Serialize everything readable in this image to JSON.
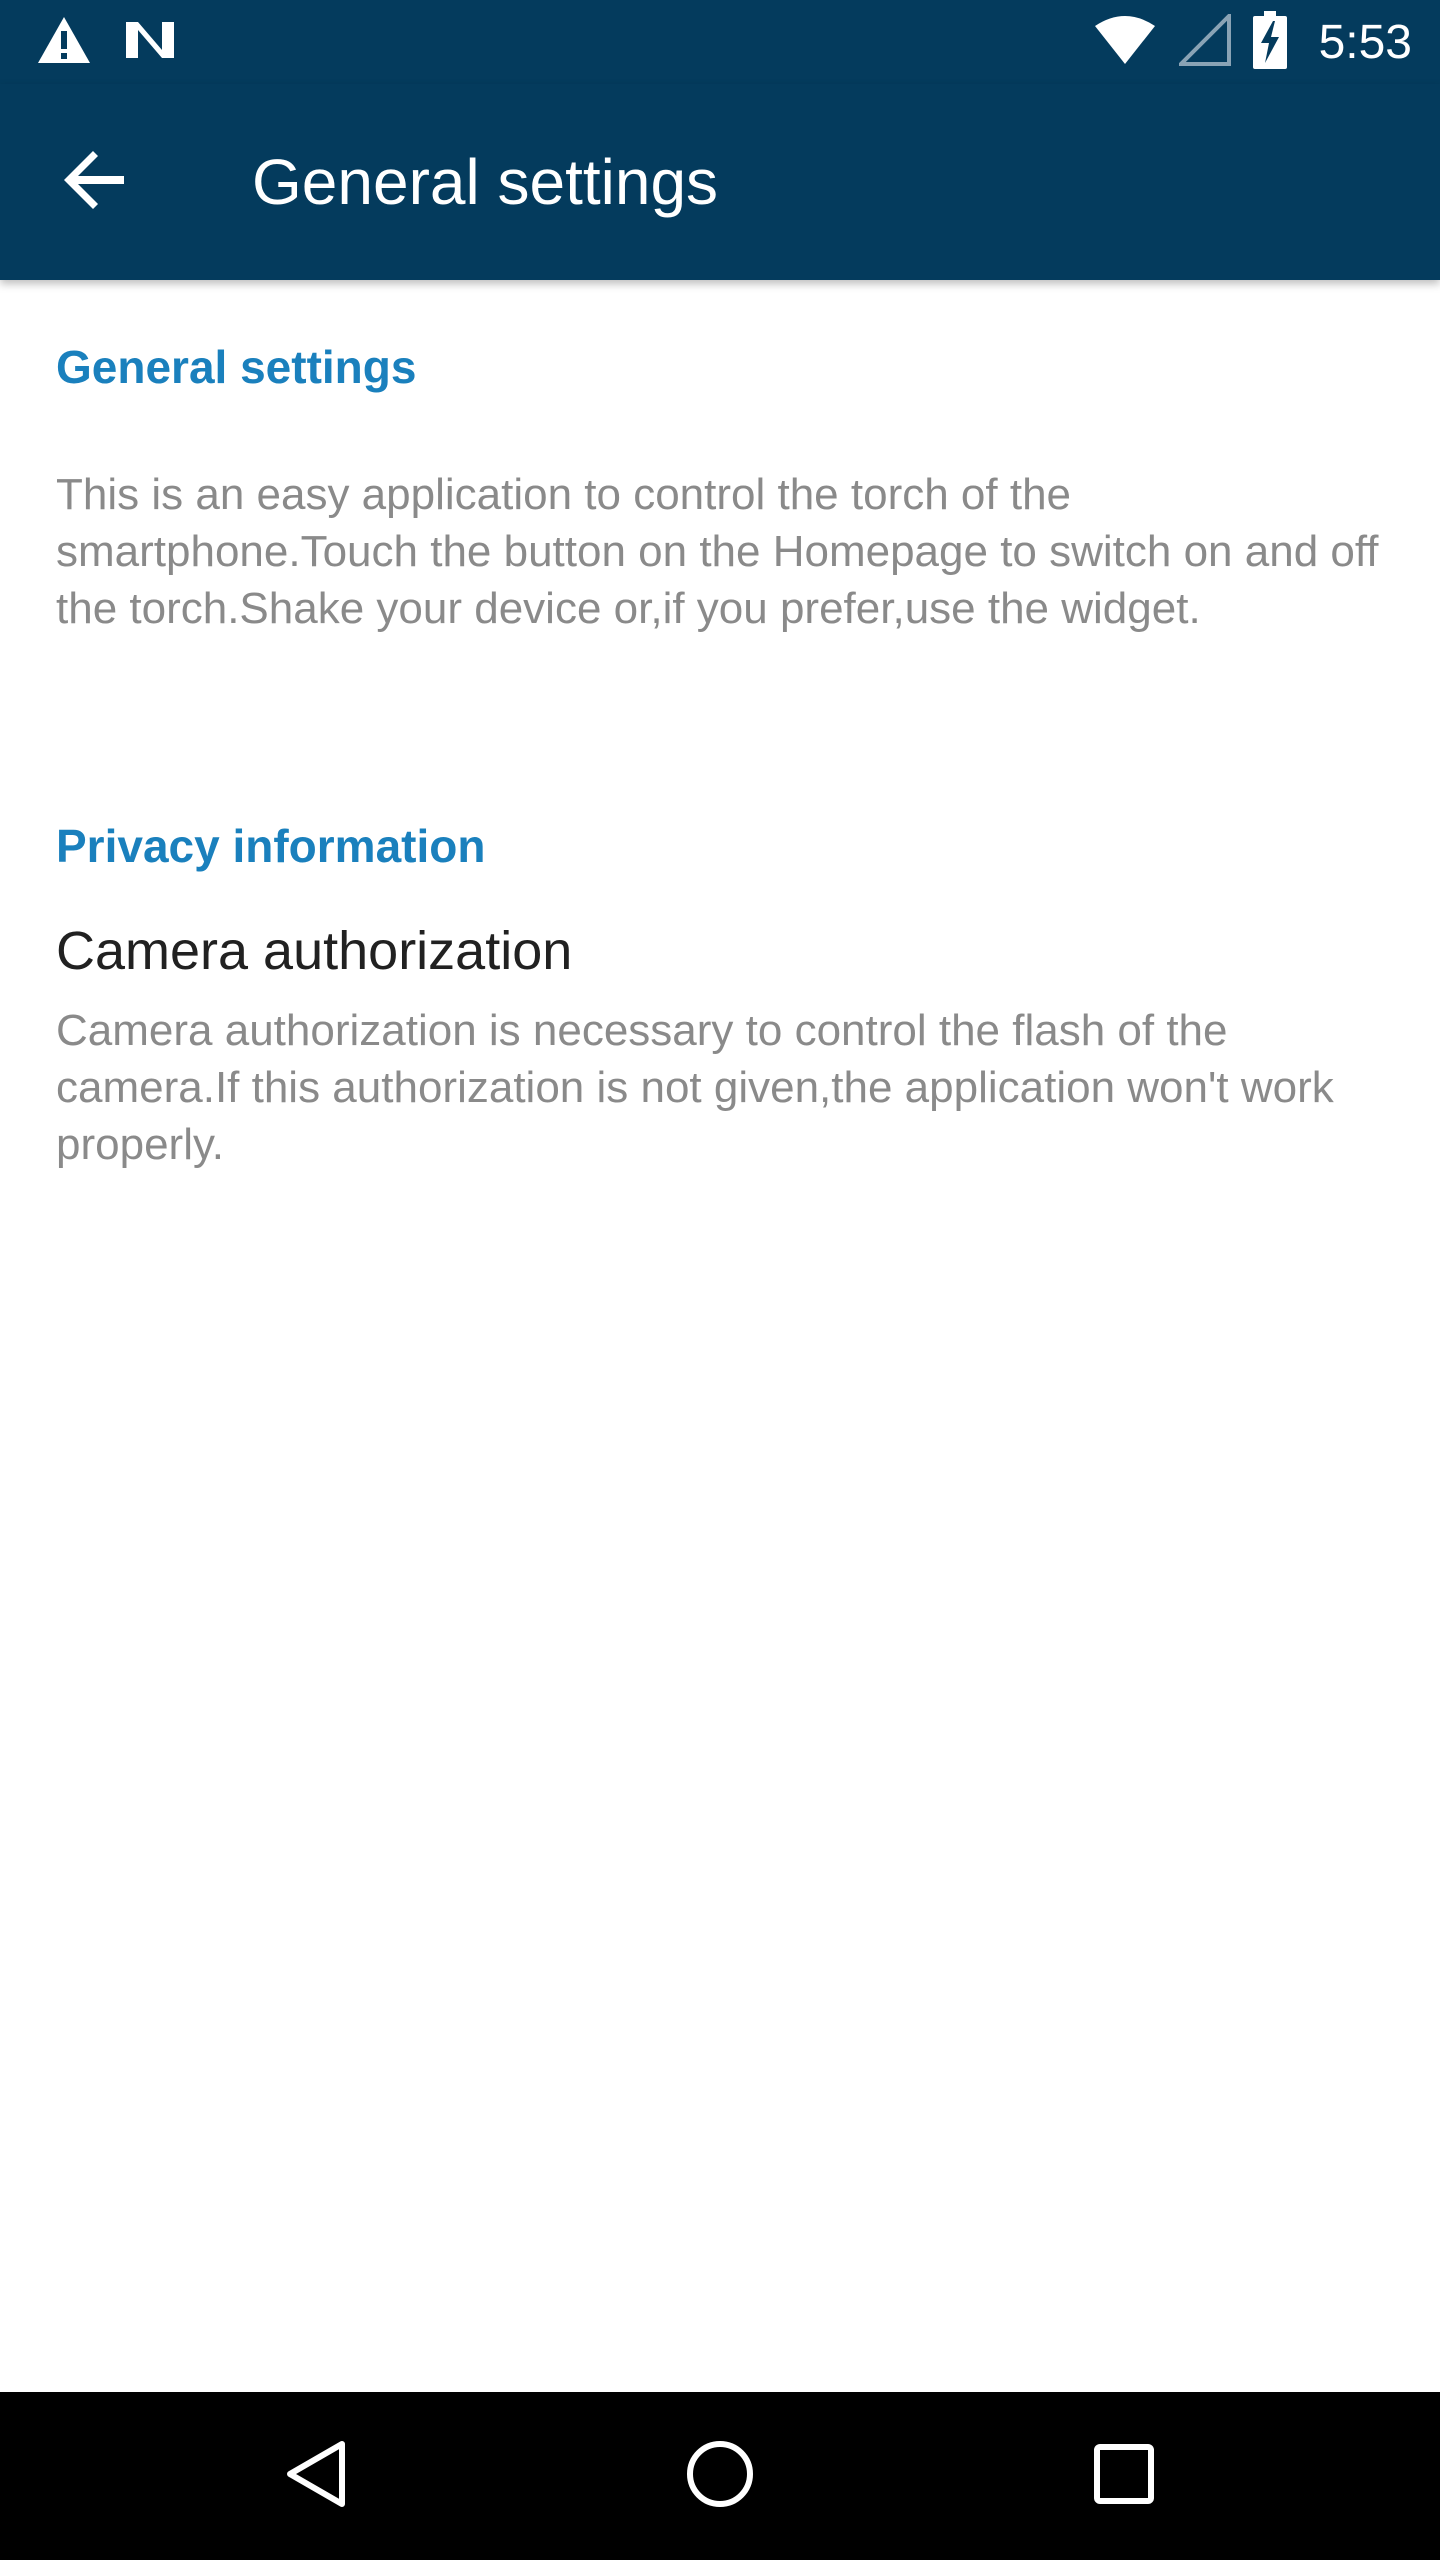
{
  "status_bar": {
    "time": "5:53",
    "icons": [
      "warning-icon",
      "n-notification-icon",
      "wifi-icon",
      "cell-signal-icon",
      "battery-charging-icon"
    ]
  },
  "app_bar": {
    "title": "General settings",
    "back_icon": "arrow-back-icon"
  },
  "sections": [
    {
      "header": "General settings",
      "summary": "This is an easy application to control the torch of the smartphone.Touch the button on the Homepage to switch on and off the torch.Shake your device or,if you prefer,use the widget."
    },
    {
      "header": "Privacy information",
      "item": {
        "title": "Camera authorization",
        "summary": "Camera authorization is necessary to control the flash of the camera.If this authorization is not given,the application won't work properly."
      }
    }
  ],
  "nav_bar": {
    "icons": [
      "back-triangle-icon",
      "home-circle-icon",
      "recents-square-icon"
    ]
  },
  "colors": {
    "app_bar": "#043b5d",
    "accent": "#1a80bd",
    "summary_text": "#8a8a8a",
    "title_text": "#212121"
  }
}
